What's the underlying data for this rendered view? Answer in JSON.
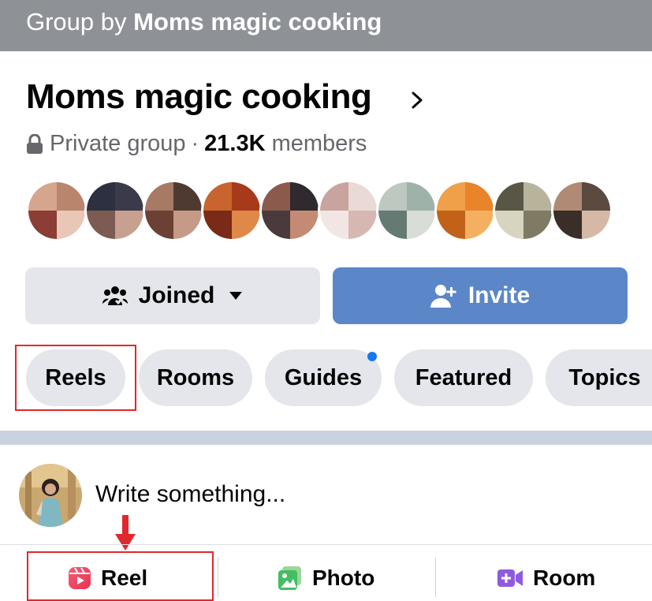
{
  "topbar": {
    "prefix": "Group by",
    "group_name": "Moms magic cooking"
  },
  "group": {
    "title": "Moms magic cooking",
    "privacy": "Private group",
    "member_count": "21.3K",
    "members_label": "members"
  },
  "actions": {
    "joined_label": "Joined",
    "invite_label": "Invite"
  },
  "tabs": [
    {
      "label": "Reels",
      "highlighted": true
    },
    {
      "label": "Rooms"
    },
    {
      "label": "Guides",
      "has_notification_dot": true
    },
    {
      "label": "Featured"
    },
    {
      "label": "Topics"
    }
  ],
  "composer": {
    "placeholder": "Write something..."
  },
  "create_bar": [
    {
      "label": "Reel",
      "icon": "reel-icon",
      "highlighted": true
    },
    {
      "label": "Photo",
      "icon": "photo-icon"
    },
    {
      "label": "Room",
      "icon": "room-icon"
    }
  ],
  "colors": {
    "topbar": "#8e9297",
    "invite": "#5b87c8",
    "chip": "#e4e6eb",
    "highlight": "#e0282e",
    "notification_dot": "#1877f2"
  }
}
